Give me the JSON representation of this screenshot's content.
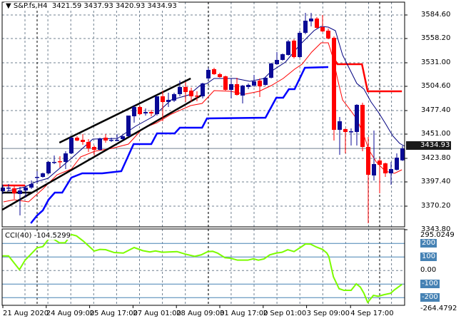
{
  "header": {
    "symbol": "S&P.fs,H4",
    "ohlc": "3421.59 3437.93 3420.93 3434.93"
  },
  "cci_header": {
    "label": "CCI(40)",
    "value": "-104.5299"
  },
  "current_price": "3434.93",
  "price_axis": [
    "3584.60",
    "3558.20",
    "3531.00",
    "3504.60",
    "3477.40",
    "3451.00",
    "3423.80",
    "3397.40",
    "3370.20",
    "3343.80"
  ],
  "cci_axis": [
    {
      "label": "295.0249",
      "value": 295.0249,
      "boxed": false
    },
    {
      "label": "200",
      "value": 200,
      "boxed": true
    },
    {
      "label": "100",
      "value": 100,
      "boxed": true
    },
    {
      "label": "0.00",
      "value": 0,
      "boxed": false
    },
    {
      "label": "-100",
      "value": -100,
      "boxed": true
    },
    {
      "label": "-200",
      "value": -200,
      "boxed": true
    },
    {
      "label": "-264.4792",
      "value": -264.4792,
      "boxed": false
    }
  ],
  "time_axis": [
    {
      "label": "21 Aug 2020",
      "index": 0
    },
    {
      "label": "24 Aug 09:00",
      "index": 7.6
    },
    {
      "label": "25 Aug 17:00",
      "index": 15.2
    },
    {
      "label": "27 Aug 01:00",
      "index": 22.8
    },
    {
      "label": "28 Aug 09:00",
      "index": 30.4
    },
    {
      "label": "31 Aug 17:00",
      "index": 38
    },
    {
      "label": "2 Sep 01:00",
      "index": 45.6
    },
    {
      "label": "3 Sep 09:00",
      "index": 53.2
    },
    {
      "label": "4 Sep 17:00",
      "index": 60.9
    }
  ],
  "colors": {
    "bull": "#0a0a96",
    "bear": "#ff0000",
    "ma_fast": "#000080",
    "ma_slow": "#ff0000",
    "support": "#0000ff",
    "resistance": "#ff0000",
    "cci": "#7cfc00",
    "level": "#4682b4"
  },
  "chart_data": {
    "type": "candlestick",
    "title": "S&P.fs,H4",
    "ylim": [
      3343.8,
      3584.6
    ],
    "cci_ylim": [
      -264.4792,
      295.0249
    ],
    "candles": [
      [
        3387.0,
        3394.2,
        3383.8,
        3391.0
      ],
      [
        3390.2,
        3395.0,
        3387.0,
        3391.0
      ],
      [
        3390.2,
        3392.6,
        3378.2,
        3384.6
      ],
      [
        3383.8,
        3391.8,
        3359.8,
        3387.8
      ],
      [
        3387.8,
        3393.4,
        3379.8,
        3391.0
      ],
      [
        3391.0,
        3399.0,
        3389.4,
        3395.0
      ],
      [
        3402.2,
        3409.4,
        3395.8,
        3403.0
      ],
      [
        3403.0,
        3407.8,
        3402.2,
        3407.0
      ],
      [
        3407.0,
        3420.6,
        3406.2,
        3419.8
      ],
      [
        3419.0,
        3427.0,
        3417.4,
        3419.8
      ],
      [
        3420.6,
        3426.2,
        3413.4,
        3419.8
      ],
      [
        3419.8,
        3431.8,
        3411.8,
        3429.4
      ],
      [
        3429.4,
        3447.8,
        3428.6,
        3447.0
      ],
      [
        3447.0,
        3448.6,
        3443.0,
        3443.8
      ],
      [
        3444.6,
        3451.0,
        3439.0,
        3442.2
      ],
      [
        3442.2,
        3445.4,
        3431.0,
        3435.0
      ],
      [
        3436.6,
        3438.2,
        3427.0,
        3433.4
      ],
      [
        3433.4,
        3447.0,
        3432.6,
        3446.2
      ],
      [
        3447.0,
        3451.0,
        3441.4,
        3443.8
      ],
      [
        3443.8,
        3447.0,
        3442.2,
        3444.6
      ],
      [
        3443.8,
        3451.0,
        3443.0,
        3444.6
      ],
      [
        3445.4,
        3449.4,
        3444.6,
        3448.6
      ],
      [
        3448.6,
        3471.8,
        3447.8,
        3471.8
      ],
      [
        3471.0,
        3483.8,
        3463.8,
        3481.4
      ],
      [
        3481.4,
        3483.0,
        3472.6,
        3473.4
      ],
      [
        3474.2,
        3479.8,
        3471.8,
        3475.8
      ],
      [
        3475.8,
        3478.2,
        3471.0,
        3474.2
      ],
      [
        3473.4,
        3493.4,
        3471.8,
        3493.4
      ],
      [
        3493.4,
        3499.8,
        3465.4,
        3487.0
      ],
      [
        3487.0,
        3497.4,
        3481.4,
        3489.4
      ],
      [
        3488.6,
        3497.4,
        3487.0,
        3495.8
      ],
      [
        3495.8,
        3511.0,
        3493.4,
        3503.8
      ],
      [
        3503.8,
        3509.4,
        3487.0,
        3498.2
      ],
      [
        3499.8,
        3503.0,
        3487.0,
        3493.4
      ],
      [
        3494.2,
        3499.0,
        3487.8,
        3493.4
      ],
      [
        3493.4,
        3508.6,
        3491.0,
        3507.8
      ],
      [
        3513.4,
        3525.4,
        3511.0,
        3523.0
      ],
      [
        3523.8,
        3525.4,
        3517.4,
        3518.2
      ],
      [
        3518.2,
        3519.8,
        3514.2,
        3515.0
      ],
      [
        3515.8,
        3516.6,
        3499.8,
        3500.6
      ],
      [
        3500.6,
        3513.4,
        3491.0,
        3507.0
      ],
      [
        3507.0,
        3514.2,
        3494.2,
        3495.0
      ],
      [
        3494.2,
        3506.2,
        3485.4,
        3505.4
      ],
      [
        3503.8,
        3507.8,
        3501.4,
        3506.2
      ],
      [
        3505.4,
        3517.4,
        3503.8,
        3510.2
      ],
      [
        3511.0,
        3513.4,
        3492.6,
        3504.6
      ],
      [
        3506.2,
        3515.0,
        3505.4,
        3514.2
      ],
      [
        3514.2,
        3531.0,
        3513.4,
        3530.2
      ],
      [
        3529.4,
        3543.0,
        3528.6,
        3534.2
      ],
      [
        3534.2,
        3541.4,
        3533.4,
        3540.6
      ],
      [
        3539.8,
        3556.6,
        3539.0,
        3555.0
      ],
      [
        3555.8,
        3557.4,
        3535.8,
        3537.4
      ],
      [
        3537.4,
        3567.0,
        3536.6,
        3564.6
      ],
      [
        3564.6,
        3587.0,
        3563.0,
        3578.2
      ],
      [
        3577.4,
        3587.0,
        3571.8,
        3580.6
      ],
      [
        3580.6,
        3582.2,
        3569.4,
        3570.2
      ],
      [
        3571.0,
        3584.6,
        3565.4,
        3566.2
      ],
      [
        3567.0,
        3569.4,
        3557.4,
        3558.2
      ],
      [
        3559.0,
        3560.6,
        3443.8,
        3455.8
      ],
      [
        3455.8,
        3470.2,
        3427.8,
        3465.4
      ],
      [
        3456.6,
        3457.4,
        3429.4,
        3453.4
      ],
      [
        3453.4,
        3457.4,
        3438.2,
        3454.2
      ],
      [
        3453.4,
        3484.6,
        3438.2,
        3483.8
      ],
      [
        3483.8,
        3486.2,
        3431.8,
        3436.6
      ],
      [
        3436.6,
        3447.8,
        3351.0,
        3405.4
      ],
      [
        3404.6,
        3455.0,
        3399.0,
        3417.4
      ],
      [
        3421.4,
        3423.8,
        3384.6,
        3416.6
      ],
      [
        3418.2,
        3419.0,
        3403.0,
        3407.0
      ],
      [
        3407.0,
        3419.8,
        3394.2,
        3411.8
      ],
      [
        3411.0,
        3429.4,
        3410.2,
        3424.6
      ],
      [
        3421.59,
        3437.93,
        3420.93,
        3434.93
      ]
    ],
    "ma_fast": [
      [
        0.75,
        3387.0
      ],
      [
        3.9,
        3391.8
      ],
      [
        5.75,
        3397.4
      ],
      [
        7.9,
        3401.4
      ],
      [
        12,
        3423.8
      ],
      [
        15.75,
        3445.4
      ],
      [
        20.1,
        3446.2
      ],
      [
        23.25,
        3459.8
      ],
      [
        26.4,
        3471.0
      ],
      [
        29.5,
        3489.4
      ],
      [
        32.6,
        3495.0
      ],
      [
        34.5,
        3505.4
      ],
      [
        35.75,
        3507.8
      ],
      [
        37,
        3513.4
      ],
      [
        40.75,
        3513.4
      ],
      [
        43.25,
        3510.2
      ],
      [
        45.75,
        3513.4
      ],
      [
        47,
        3521.4
      ],
      [
        49.5,
        3531.8
      ],
      [
        52,
        3551.0
      ],
      [
        54.5,
        3567.0
      ],
      [
        55.75,
        3571.8
      ],
      [
        57,
        3571.0
      ],
      [
        58.25,
        3567.0
      ],
      [
        59.5,
        3539.8
      ],
      [
        60.75,
        3523.8
      ],
      [
        62,
        3507.8
      ],
      [
        63.25,
        3501.4
      ],
      [
        64.5,
        3487.0
      ],
      [
        65.75,
        3475.8
      ],
      [
        67,
        3463.0
      ],
      [
        68.25,
        3449.4
      ],
      [
        69.5,
        3440.6
      ],
      [
        70.4,
        3437.4
      ]
    ],
    "ma_slow": [
      [
        0.1,
        3375.0
      ],
      [
        2,
        3377.4
      ],
      [
        4.5,
        3375.0
      ],
      [
        7,
        3389.4
      ],
      [
        9.5,
        3405.4
      ],
      [
        12,
        3411.8
      ],
      [
        13.6,
        3425.4
      ],
      [
        16.1,
        3431.8
      ],
      [
        19.1,
        3435.0
      ],
      [
        22,
        3439.8
      ],
      [
        24.5,
        3457.4
      ],
      [
        27,
        3463.8
      ],
      [
        29.5,
        3473.4
      ],
      [
        32.9,
        3483.0
      ],
      [
        34.9,
        3485.4
      ],
      [
        37,
        3499.8
      ],
      [
        39.9,
        3499.0
      ],
      [
        42.4,
        3495.8
      ],
      [
        44.9,
        3499.0
      ],
      [
        47,
        3505.4
      ],
      [
        49.1,
        3513.4
      ],
      [
        51.1,
        3523.8
      ],
      [
        52.4,
        3529.4
      ],
      [
        54.1,
        3543.0
      ],
      [
        55.75,
        3553.4
      ],
      [
        57,
        3553.4
      ],
      [
        57.9,
        3535.0
      ],
      [
        58.6,
        3513.4
      ],
      [
        59.5,
        3489.4
      ],
      [
        60.75,
        3479.0
      ],
      [
        62,
        3467.8
      ],
      [
        63.25,
        3449.4
      ],
      [
        64.1,
        3433.4
      ],
      [
        65.4,
        3419.8
      ],
      [
        67,
        3409.4
      ],
      [
        68.6,
        3407.0
      ],
      [
        69.9,
        3411.0
      ]
    ],
    "support_step": [
      [
        4.9,
        3351.0
      ],
      [
        6,
        3359.8
      ],
      [
        7,
        3365.4
      ],
      [
        8,
        3377.4
      ],
      [
        9.1,
        3385.4
      ],
      [
        10.4,
        3385.4
      ],
      [
        12,
        3402.2
      ],
      [
        13.9,
        3407.0
      ],
      [
        17.4,
        3407.0
      ],
      [
        20.75,
        3409.4
      ],
      [
        22.9,
        3439.8
      ],
      [
        26,
        3439.8
      ],
      [
        27,
        3451.8
      ],
      [
        30.1,
        3451.8
      ],
      [
        31,
        3458.2
      ],
      [
        34.9,
        3458.2
      ],
      [
        35.75,
        3468.6
      ],
      [
        46,
        3469.4
      ],
      [
        47.9,
        3491.8
      ],
      [
        49.1,
        3491.8
      ],
      [
        50.1,
        3501.4
      ],
      [
        51.1,
        3501.4
      ],
      [
        52.9,
        3525.4
      ],
      [
        57,
        3526.2
      ]
    ],
    "resistance_step": [
      [
        58,
        3535.8
      ],
      [
        58.6,
        3529.4
      ],
      [
        62.9,
        3529.4
      ],
      [
        63.9,
        3499.0
      ],
      [
        69.9,
        3499.0
      ]
    ],
    "early_resistance": [
      [
        -0.1,
        3393.4
      ],
      [
        3.9,
        3393.4
      ]
    ],
    "early_level": [
      [
        -0.1,
        3385.4
      ],
      [
        5.1,
        3385.4
      ]
    ],
    "channel_upper": [
      [
        9.9,
        3441.4
      ],
      [
        32.9,
        3513.4
      ]
    ],
    "channel_lower": [
      [
        -0.1,
        3366.2
      ],
      [
        34.9,
        3495.0
      ]
    ],
    "cci": [
      [
        -0.1,
        108
      ],
      [
        1,
        108
      ],
      [
        2.9,
        7
      ],
      [
        3.9,
        77
      ],
      [
        6,
        168
      ],
      [
        7,
        177
      ],
      [
        8,
        232
      ],
      [
        8.9,
        232
      ],
      [
        9.9,
        205
      ],
      [
        10.9,
        205
      ],
      [
        12,
        266
      ],
      [
        12.9,
        256
      ],
      [
        14.1,
        217
      ],
      [
        16,
        144
      ],
      [
        17,
        156
      ],
      [
        18,
        154
      ],
      [
        19.5,
        133
      ],
      [
        21.1,
        129
      ],
      [
        23,
        170
      ],
      [
        24.5,
        147
      ],
      [
        25.75,
        137
      ],
      [
        26.75,
        145
      ],
      [
        27.9,
        135
      ],
      [
        30.5,
        140
      ],
      [
        32,
        121
      ],
      [
        33.6,
        105
      ],
      [
        34.75,
        116
      ],
      [
        35.9,
        140
      ],
      [
        36.75,
        142
      ],
      [
        37.6,
        129
      ],
      [
        38.9,
        95
      ],
      [
        39.9,
        91
      ],
      [
        41.1,
        77
      ],
      [
        42.9,
        77
      ],
      [
        43.9,
        87
      ],
      [
        44.75,
        77
      ],
      [
        45.75,
        86
      ],
      [
        46.75,
        116
      ],
      [
        47.9,
        129
      ],
      [
        48.9,
        135
      ],
      [
        49.9,
        154
      ],
      [
        51,
        140
      ],
      [
        52.25,
        174
      ],
      [
        53,
        196
      ],
      [
        53.9,
        195
      ],
      [
        54.9,
        174
      ],
      [
        56,
        156
      ],
      [
        56.75,
        129
      ],
      [
        57.1,
        103
      ],
      [
        57.9,
        -46
      ],
      [
        58.9,
        -134
      ],
      [
        59.75,
        -146
      ],
      [
        61,
        -146
      ],
      [
        61.9,
        -98
      ],
      [
        62.6,
        -121
      ],
      [
        63.25,
        -168
      ],
      [
        63.9,
        -235
      ],
      [
        64.9,
        -183
      ],
      [
        65.75,
        -190
      ],
      [
        66.75,
        -178
      ],
      [
        67.9,
        -168
      ],
      [
        68.6,
        -142
      ],
      [
        69.9,
        -102
      ]
    ]
  }
}
